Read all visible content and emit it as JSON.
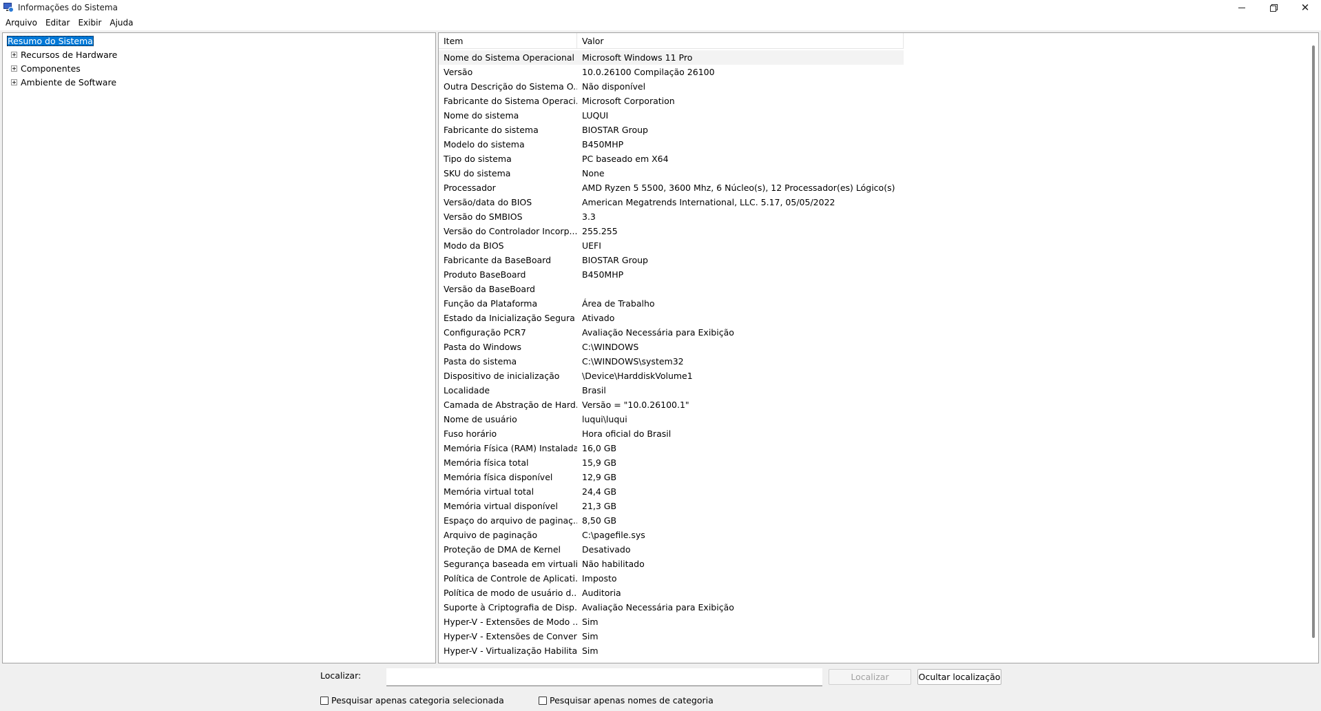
{
  "window": {
    "title": "Informações do Sistema",
    "icon": "system-info-icon",
    "controls": {
      "minimize": "minimize-icon",
      "restore": "restore-icon",
      "close": "close-icon"
    },
    "close_glyph": "✕"
  },
  "menu": [
    "Arquivo",
    "Editar",
    "Exibir",
    "Ajuda"
  ],
  "tree": {
    "root": "Resumo do Sistema",
    "children": [
      "Recursos de Hardware",
      "Componentes",
      "Ambiente de Software"
    ]
  },
  "list": {
    "columns": {
      "item": "Item",
      "value": "Valor"
    },
    "rows": [
      {
        "item": "Nome do Sistema Operacional",
        "value": "Microsoft Windows 11 Pro"
      },
      {
        "item": "Versão",
        "value": "10.0.26100 Compilação 26100"
      },
      {
        "item": "Outra Descrição do Sistema O...",
        "value": "Não disponível"
      },
      {
        "item": "Fabricante do Sistema Operaci...",
        "value": "Microsoft Corporation"
      },
      {
        "item": "Nome do sistema",
        "value": "LUQUI"
      },
      {
        "item": "Fabricante do sistema",
        "value": "BIOSTAR Group"
      },
      {
        "item": "Modelo do sistema",
        "value": "B450MHP"
      },
      {
        "item": "Tipo do sistema",
        "value": "PC baseado em X64"
      },
      {
        "item": "SKU do sistema",
        "value": "None"
      },
      {
        "item": "Processador",
        "value": "AMD Ryzen 5 5500, 3600 Mhz, 6 Núcleo(s), 12 Processador(es) Lógico(s)"
      },
      {
        "item": "Versão/data do BIOS",
        "value": "American Megatrends International, LLC. 5.17, 05/05/2022"
      },
      {
        "item": "Versão do SMBIOS",
        "value": "3.3"
      },
      {
        "item": "Versão do Controlador Incorp...",
        "value": "255.255"
      },
      {
        "item": "Modo da BIOS",
        "value": "UEFI"
      },
      {
        "item": "Fabricante da BaseBoard",
        "value": "BIOSTAR Group"
      },
      {
        "item": "Produto BaseBoard",
        "value": "B450MHP"
      },
      {
        "item": "Versão da BaseBoard",
        "value": ""
      },
      {
        "item": "Função da Plataforma",
        "value": "Área de Trabalho"
      },
      {
        "item": "Estado da Inicialização Segura",
        "value": "Ativado"
      },
      {
        "item": "Configuração PCR7",
        "value": "Avaliação Necessária para Exibição"
      },
      {
        "item": "Pasta do Windows",
        "value": "C:\\WINDOWS"
      },
      {
        "item": "Pasta do sistema",
        "value": "C:\\WINDOWS\\system32"
      },
      {
        "item": "Dispositivo de inicialização",
        "value": "\\Device\\HarddiskVolume1"
      },
      {
        "item": "Localidade",
        "value": "Brasil"
      },
      {
        "item": "Camada de Abstração de Hard...",
        "value": "Versão = \"10.0.26100.1\""
      },
      {
        "item": "Nome de usuário",
        "value": "luqui\\luqui"
      },
      {
        "item": "Fuso horário",
        "value": "Hora oficial do Brasil"
      },
      {
        "item": "Memória Física (RAM) Instalada",
        "value": "16,0 GB"
      },
      {
        "item": "Memória física total",
        "value": "15,9 GB"
      },
      {
        "item": "Memória física disponível",
        "value": "12,9 GB"
      },
      {
        "item": "Memória virtual total",
        "value": "24,4 GB"
      },
      {
        "item": "Memória virtual disponível",
        "value": "21,3 GB"
      },
      {
        "item": "Espaço do arquivo de paginaç...",
        "value": "8,50 GB"
      },
      {
        "item": "Arquivo de paginação",
        "value": "C:\\pagefile.sys"
      },
      {
        "item": "Proteção de DMA de Kernel",
        "value": "Desativado"
      },
      {
        "item": "Segurança baseada em virtuali...",
        "value": "Não habilitado"
      },
      {
        "item": "Política de Controle de Aplicati...",
        "value": "Imposto"
      },
      {
        "item": "Política de modo de usuário d...",
        "value": "Auditoria"
      },
      {
        "item": "Suporte à Criptografia de Disp...",
        "value": "Avaliação Necessária para Exibição"
      },
      {
        "item": "Hyper-V - Extensões de Modo ...",
        "value": "Sim"
      },
      {
        "item": "Hyper-V - Extensões de Conver...",
        "value": "Sim"
      },
      {
        "item": "Hyper-V - Virtualização Habilita...",
        "value": "Sim"
      }
    ]
  },
  "find": {
    "label": "Localizar:",
    "input_value": "",
    "find_button": "Localizar",
    "hide_button": "Ocultar localização",
    "checkbox_selected_category": "Pesquisar apenas categoria selecionada",
    "checkbox_category_names": "Pesquisar apenas nomes de categoria"
  }
}
